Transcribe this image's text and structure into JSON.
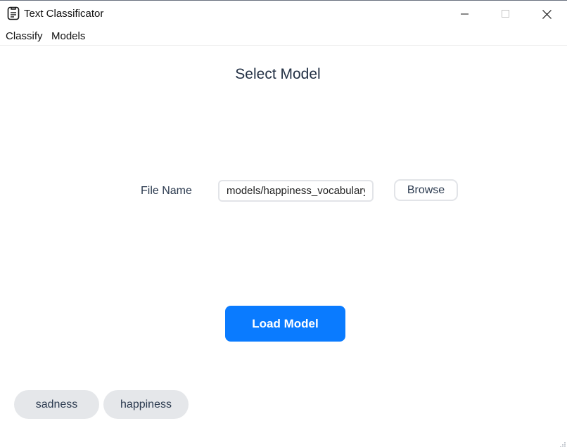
{
  "window": {
    "title": "Text Classificator",
    "app_icon": "document-icon",
    "controls": [
      "minimize-icon",
      "maximize-icon",
      "close-icon"
    ]
  },
  "menubar": {
    "items": [
      {
        "label": "Classify"
      },
      {
        "label": "Models"
      }
    ]
  },
  "main": {
    "heading": "Select Model",
    "file_name_label": "File Name",
    "file_name_value": "models/happiness_vocabulary",
    "browse_label": "Browse",
    "load_label": "Load Model"
  },
  "models": {
    "chips": [
      {
        "label": "sadness"
      },
      {
        "label": "happiness"
      }
    ]
  },
  "colors": {
    "accent": "#0a7bff",
    "chip_bg": "#e5e7ea",
    "text": "#2b3a4f"
  }
}
